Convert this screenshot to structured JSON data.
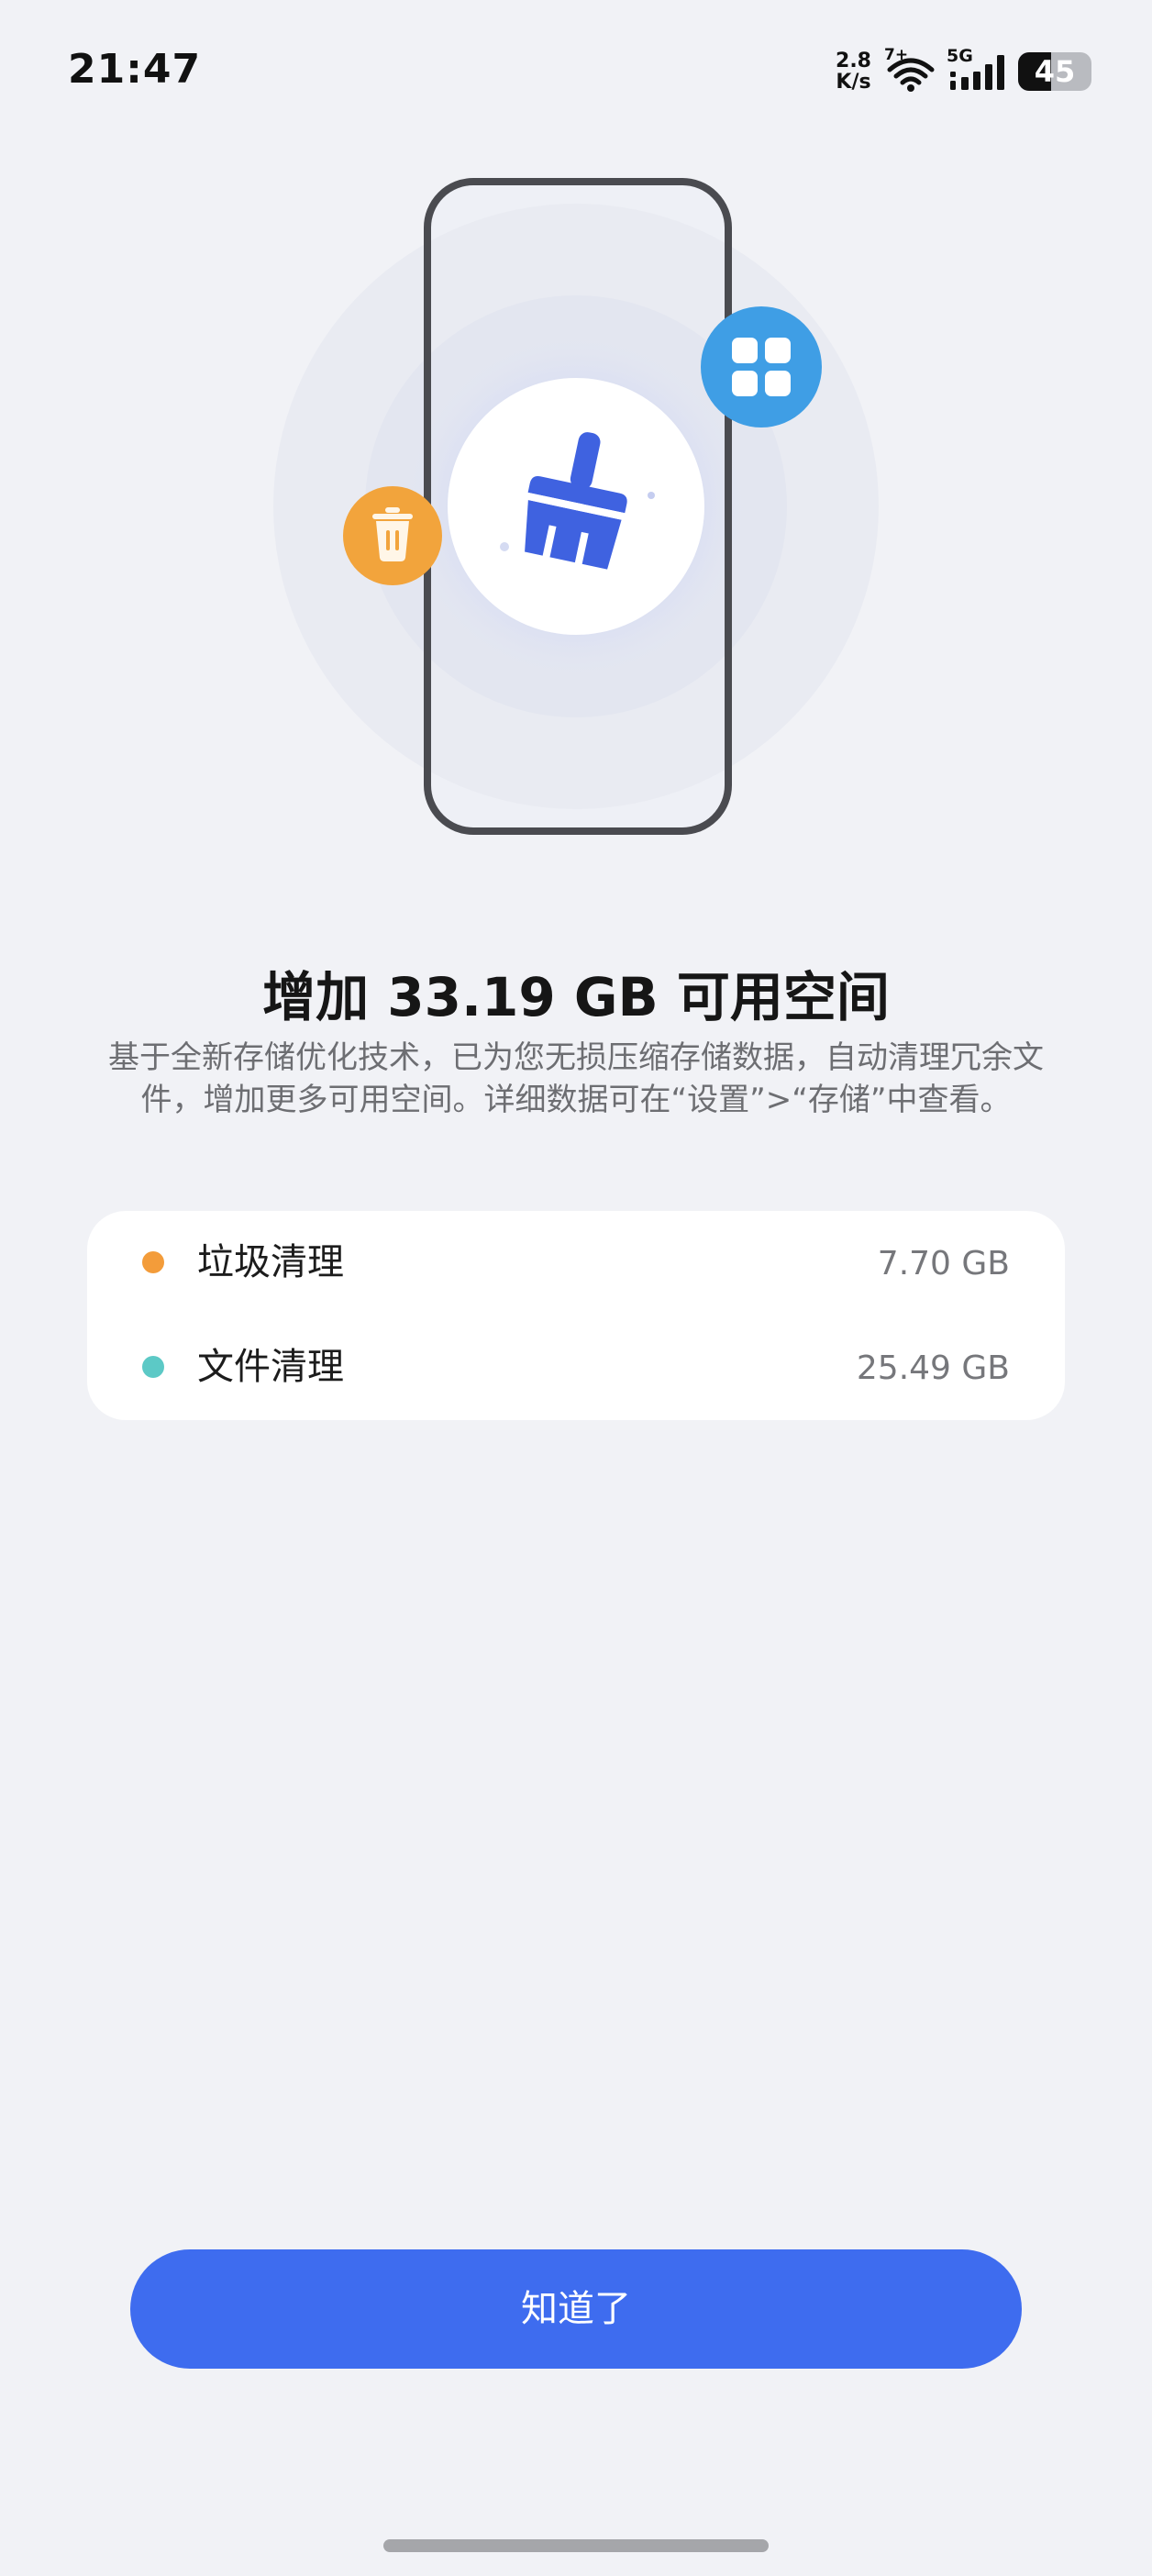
{
  "status_bar": {
    "time": "21:47",
    "net_speed_value": "2.8",
    "net_speed_unit": "K/s",
    "wifi_label": "7+",
    "cell_label": "5G",
    "battery_level": 45,
    "battery_text": "45"
  },
  "illustration": {
    "icons": [
      "phone-outline",
      "broom-icon",
      "trash-icon",
      "grid-apps-icon"
    ],
    "colors": {
      "broom": "#3f62e0",
      "trash_badge": "#f2a43c",
      "grid_badge": "#3f9ee5",
      "phone_frame": "#4a4b50"
    }
  },
  "headline": "增加 33.19 GB 可用空间",
  "description": "基于全新存储优化技术，已为您无损压缩存储数据，自动清理冗余文件，增加更多可用空间。详细数据可在“设置”>“存储”中查看。",
  "breakdown": {
    "items": [
      {
        "label": "垃圾清理",
        "value": "7.70 GB",
        "color": "#f39c3a"
      },
      {
        "label": "文件清理",
        "value": "25.49 GB",
        "color": "#5cc9c6"
      }
    ]
  },
  "actions": {
    "confirm_label": "知道了"
  },
  "colors": {
    "background": "#f1f2f6",
    "primary_button": "#3e6cef"
  }
}
